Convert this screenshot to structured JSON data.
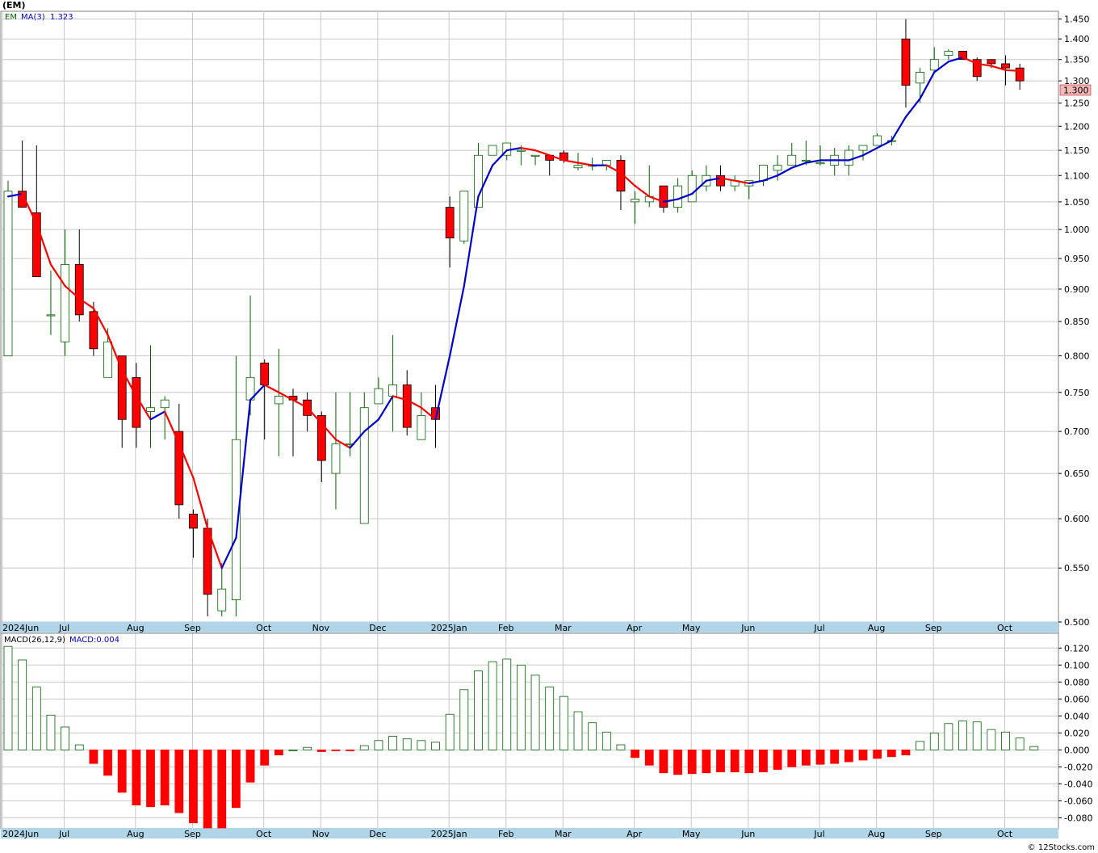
{
  "header": {
    "symbol_title": "(EM)",
    "legend_symbol": "EM",
    "legend_ma": "MA(3)",
    "legend_ma_value": "1.323",
    "macd_title": "MACD(26,12,9)",
    "macd_value": "MACD:0.004",
    "watermark": "© 12Stocks.com",
    "last_price_tag": "1.300"
  },
  "colors": {
    "up_candle": "#006400",
    "down_candle": "#ff0000",
    "ma_up": "#0000cc",
    "ma_down": "#ff0000",
    "macd_pos": "#006400",
    "macd_neg": "#ff0000",
    "axis_strip": "#b0d4e8",
    "grid": "#c8c8c8",
    "legend_text": "#0000cc",
    "legend_sym": "#006400",
    "price_tag_bg": "#f4b8b8"
  },
  "chart_data": [
    {
      "type": "candlestick",
      "yaxis_scale": "log",
      "ylim": [
        0.5,
        1.47
      ],
      "yticks": [
        "1.450",
        "1.400",
        "1.350",
        "1.300",
        "1.250",
        "1.200",
        "1.150",
        "1.100",
        "1.050",
        "1.000",
        "0.950",
        "0.900",
        "0.850",
        "0.800",
        "0.750",
        "0.700",
        "0.650",
        "0.600",
        "0.550",
        "0.500"
      ],
      "yticks_values": [
        1.45,
        1.4,
        1.35,
        1.3,
        1.25,
        1.2,
        1.15,
        1.1,
        1.05,
        1.0,
        0.95,
        0.9,
        0.85,
        0.8,
        0.75,
        0.7,
        0.65,
        0.6,
        0.55,
        0.5
      ],
      "x_labels": [
        {
          "label": "2024Jun",
          "week": 0
        },
        {
          "label": "Jul",
          "week": 4
        },
        {
          "label": "Aug",
          "week": 9
        },
        {
          "label": "Sep",
          "week": 13
        },
        {
          "label": "Oct",
          "week": 18
        },
        {
          "label": "Nov",
          "week": 22
        },
        {
          "label": "Dec",
          "week": 26
        },
        {
          "label": "2025Jan",
          "week": 31
        },
        {
          "label": "Feb",
          "week": 35
        },
        {
          "label": "Mar",
          "week": 39
        },
        {
          "label": "Apr",
          "week": 44
        },
        {
          "label": "May",
          "week": 48
        },
        {
          "label": "Jun",
          "week": 52
        },
        {
          "label": "Jul",
          "week": 57
        },
        {
          "label": "Aug",
          "week": 61
        },
        {
          "label": "Sep",
          "week": 65
        },
        {
          "label": "Oct",
          "week": 70
        }
      ],
      "grid": true,
      "candles": [
        [
          0.8,
          1.09,
          0.8,
          1.07
        ],
        [
          1.07,
          1.17,
          1.04,
          1.04
        ],
        [
          1.03,
          1.16,
          0.92,
          0.92
        ],
        [
          0.86,
          0.93,
          0.83,
          0.86
        ],
        [
          0.82,
          1.0,
          0.8,
          0.94
        ],
        [
          0.94,
          1.0,
          0.85,
          0.86
        ],
        [
          0.865,
          0.88,
          0.8,
          0.81
        ],
        [
          0.77,
          0.84,
          0.77,
          0.82
        ],
        [
          0.8,
          0.8,
          0.68,
          0.715
        ],
        [
          0.77,
          0.79,
          0.68,
          0.705
        ],
        [
          0.725,
          0.815,
          0.68,
          0.73
        ],
        [
          0.73,
          0.745,
          0.69,
          0.74
        ],
        [
          0.7,
          0.735,
          0.6,
          0.615
        ],
        [
          0.605,
          0.61,
          0.56,
          0.59
        ],
        [
          0.59,
          0.6,
          0.505,
          0.525
        ],
        [
          0.51,
          0.555,
          0.505,
          0.53
        ],
        [
          0.52,
          0.8,
          0.505,
          0.69
        ],
        [
          0.74,
          0.89,
          0.72,
          0.77
        ],
        [
          0.79,
          0.795,
          0.69,
          0.76
        ],
        [
          0.735,
          0.81,
          0.67,
          0.745
        ],
        [
          0.745,
          0.755,
          0.67,
          0.74
        ],
        [
          0.74,
          0.75,
          0.7,
          0.72
        ],
        [
          0.72,
          0.725,
          0.64,
          0.665
        ],
        [
          0.65,
          0.75,
          0.61,
          0.685
        ],
        [
          0.685,
          0.75,
          0.67,
          0.685
        ],
        [
          0.595,
          0.75,
          0.595,
          0.73
        ],
        [
          0.735,
          0.77,
          0.735,
          0.755
        ],
        [
          0.745,
          0.83,
          0.7,
          0.76
        ],
        [
          0.76,
          0.78,
          0.695,
          0.705
        ],
        [
          0.69,
          0.75,
          0.69,
          0.72
        ],
        [
          0.73,
          0.76,
          0.68,
          0.715
        ],
        [
          1.04,
          1.06,
          0.935,
          0.985
        ],
        [
          0.98,
          1.07,
          0.975,
          1.07
        ],
        [
          1.04,
          1.165,
          1.04,
          1.14
        ],
        [
          1.14,
          1.16,
          1.14,
          1.16
        ],
        [
          1.14,
          1.165,
          1.13,
          1.165
        ],
        [
          1.15,
          1.16,
          1.12,
          1.15
        ],
        [
          1.14,
          1.14,
          1.12,
          1.14
        ],
        [
          1.14,
          1.14,
          1.1,
          1.13
        ],
        [
          1.145,
          1.15,
          1.125,
          1.13
        ],
        [
          1.115,
          1.145,
          1.11,
          1.12
        ],
        [
          1.12,
          1.135,
          1.11,
          1.12
        ],
        [
          1.12,
          1.13,
          1.11,
          1.13
        ],
        [
          1.13,
          1.14,
          1.035,
          1.07
        ],
        [
          1.05,
          1.07,
          1.01,
          1.055
        ],
        [
          1.05,
          1.12,
          1.04,
          1.06
        ],
        [
          1.08,
          1.08,
          1.03,
          1.04
        ],
        [
          1.04,
          1.095,
          1.03,
          1.08
        ],
        [
          1.05,
          1.11,
          1.05,
          1.1
        ],
        [
          1.08,
          1.12,
          1.07,
          1.1
        ],
        [
          1.1,
          1.12,
          1.07,
          1.08
        ],
        [
          1.08,
          1.1,
          1.07,
          1.09
        ],
        [
          1.08,
          1.09,
          1.055,
          1.09
        ],
        [
          1.09,
          1.12,
          1.08,
          1.12
        ],
        [
          1.11,
          1.14,
          1.09,
          1.12
        ],
        [
          1.12,
          1.165,
          1.12,
          1.14
        ],
        [
          1.13,
          1.17,
          1.12,
          1.13
        ],
        [
          1.125,
          1.16,
          1.12,
          1.125
        ],
        [
          1.12,
          1.155,
          1.1,
          1.14
        ],
        [
          1.12,
          1.16,
          1.1,
          1.15
        ],
        [
          1.15,
          1.16,
          1.13,
          1.16
        ],
        [
          1.16,
          1.185,
          1.16,
          1.18
        ],
        [
          1.17,
          1.18,
          1.16,
          1.17
        ],
        [
          1.4,
          1.45,
          1.24,
          1.29
        ],
        [
          1.295,
          1.33,
          1.25,
          1.32
        ],
        [
          1.325,
          1.38,
          1.32,
          1.35
        ],
        [
          1.36,
          1.375,
          1.35,
          1.37
        ],
        [
          1.37,
          1.37,
          1.35,
          1.35
        ],
        [
          1.35,
          1.355,
          1.3,
          1.31
        ],
        [
          1.35,
          1.35,
          1.33,
          1.34
        ],
        [
          1.34,
          1.36,
          1.29,
          1.33
        ],
        [
          1.33,
          1.34,
          1.28,
          1.3
        ]
      ],
      "ma3": [
        1.06,
        1.065,
        1.01,
        0.94,
        0.905,
        0.885,
        0.87,
        0.83,
        0.78,
        0.745,
        0.715,
        0.725,
        0.685,
        0.645,
        0.59,
        0.55,
        0.58,
        0.74,
        0.76,
        0.75,
        0.74,
        0.73,
        0.71,
        0.69,
        0.68,
        0.7,
        0.715,
        0.745,
        0.74,
        0.73,
        0.715,
        0.8,
        0.905,
        1.06,
        1.12,
        1.15,
        1.155,
        1.15,
        1.14,
        1.13,
        1.125,
        1.12,
        1.12,
        1.105,
        1.08,
        1.06,
        1.05,
        1.055,
        1.065,
        1.09,
        1.095,
        1.09,
        1.085,
        1.09,
        1.1,
        1.115,
        1.125,
        1.13,
        1.13,
        1.13,
        1.14,
        1.155,
        1.17,
        1.22,
        1.26,
        1.32,
        1.345,
        1.355,
        1.34,
        1.335,
        1.325,
        1.323
      ]
    },
    {
      "type": "bar",
      "name": "MACD(26,12,9)",
      "ylim": [
        -0.092,
        0.126
      ],
      "yticks": [
        "0.120",
        "0.100",
        "0.080",
        "0.060",
        "0.040",
        "0.020",
        "0.000",
        "-0.020",
        "-0.040",
        "-0.060",
        "-0.080"
      ],
      "yticks_values": [
        0.12,
        0.1,
        0.08,
        0.06,
        0.04,
        0.02,
        0.0,
        -0.02,
        -0.04,
        -0.06,
        -0.08
      ],
      "values": [
        0.122,
        0.106,
        0.074,
        0.041,
        0.027,
        0.006,
        -0.016,
        -0.03,
        -0.05,
        -0.065,
        -0.067,
        -0.065,
        -0.074,
        -0.086,
        -0.092,
        -0.092,
        -0.068,
        -0.038,
        -0.018,
        -0.006,
        0.0,
        0.003,
        -0.002,
        -0.001,
        -0.001,
        0.005,
        0.011,
        0.016,
        0.013,
        0.011,
        0.009,
        0.042,
        0.071,
        0.093,
        0.104,
        0.107,
        0.1,
        0.088,
        0.074,
        0.063,
        0.045,
        0.032,
        0.021,
        0.006,
        -0.009,
        -0.018,
        -0.027,
        -0.029,
        -0.028,
        -0.027,
        -0.026,
        -0.026,
        -0.027,
        -0.026,
        -0.023,
        -0.02,
        -0.018,
        -0.017,
        -0.016,
        -0.014,
        -0.012,
        -0.01,
        -0.008,
        -0.006,
        0.01,
        0.02,
        0.031,
        0.034,
        0.033,
        0.024,
        0.021,
        0.014,
        0.004
      ]
    }
  ]
}
